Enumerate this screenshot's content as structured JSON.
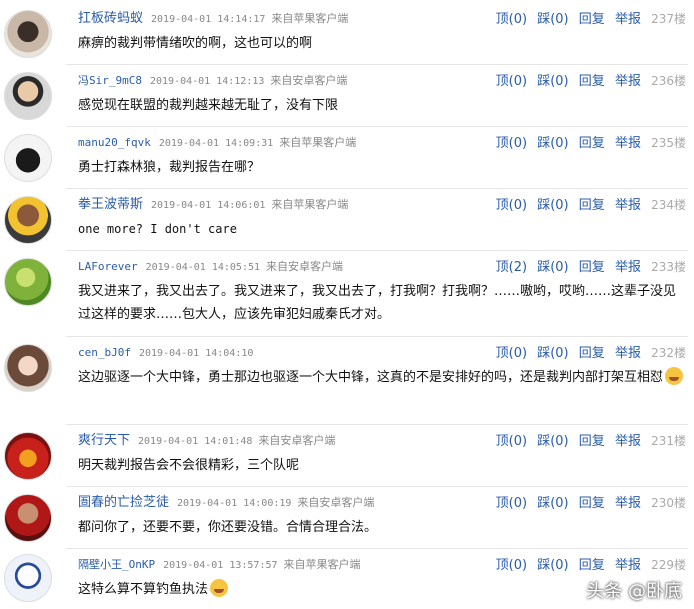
{
  "action_labels": {
    "up": "顶",
    "down": "踩",
    "reply": "回复",
    "report": "举报"
  },
  "comments": [
    {
      "username": "扛板砖蚂蚁",
      "time": "2019-04-01 14:14:17",
      "source": "来自苹果客户端",
      "up": "(0)",
      "down": "(0)",
      "floor": "237楼",
      "text": "麻痹的裁判带情绪吹的啊，这也可以的啊"
    },
    {
      "username": "冯Sir_9mC8",
      "time": "2019-04-01 14:12:13",
      "source": "来自安卓客户端",
      "up": "(0)",
      "down": "(0)",
      "floor": "236楼",
      "text": "感觉现在联盟的裁判越来越无耻了，没有下限"
    },
    {
      "username": "manu20_fqvk",
      "time": "2019-04-01 14:09:31",
      "source": "来自苹果客户端",
      "up": "(0)",
      "down": "(0)",
      "floor": "235楼",
      "text": "勇士打森林狼，裁判报告在哪？"
    },
    {
      "username": "拳王波蒂斯",
      "time": "2019-04-01 14:06:01",
      "source": "来自苹果客户端",
      "up": "(0)",
      "down": "(0)",
      "floor": "234楼",
      "text": "one more? I don't care"
    },
    {
      "username": "LAForever",
      "time": "2019-04-01 14:05:51",
      "source": "来自安卓客户端",
      "up": "(2)",
      "down": "(0)",
      "floor": "233楼",
      "text": "我又进来了，我又出去了。我又进来了，我又出去了，打我啊？打我啊？……嗷哟，哎哟……这辈子没见过这样的要求……包大人，应该先审犯妇戚秦氏才对。"
    },
    {
      "username": "cen_bJ0f",
      "time": "2019-04-01 14:04:10",
      "source": "",
      "up": "(0)",
      "down": "(0)",
      "floor": "232楼",
      "text": "这边驱逐一个大中锋，勇士那边也驱逐一个大中锋，这真的不是安排好的吗，还是裁判内部打架互相怼"
    },
    {
      "username": "爽行天下",
      "time": "2019-04-01 14:01:48",
      "source": "来自安卓客户端",
      "up": "(0)",
      "down": "(0)",
      "floor": "231楼",
      "text": "明天裁判报告会不会很精彩，三个队呢"
    },
    {
      "username": "圄春的亡捡芝徒",
      "time": "2019-04-01 14:00:19",
      "source": "来自安卓客户端",
      "up": "(0)",
      "down": "(0)",
      "floor": "230楼",
      "text": "都问你了，还要不要，你还要没错。合情合理合法。"
    },
    {
      "username": "隔壁小王_OnKP",
      "time": "2019-04-01 13:57:57",
      "source": "来自苹果客户端",
      "up": "(0)",
      "down": "(0)",
      "floor": "229楼",
      "text": "这特么算不算钓鱼执法"
    }
  ],
  "watermark": "头条 @卧底"
}
